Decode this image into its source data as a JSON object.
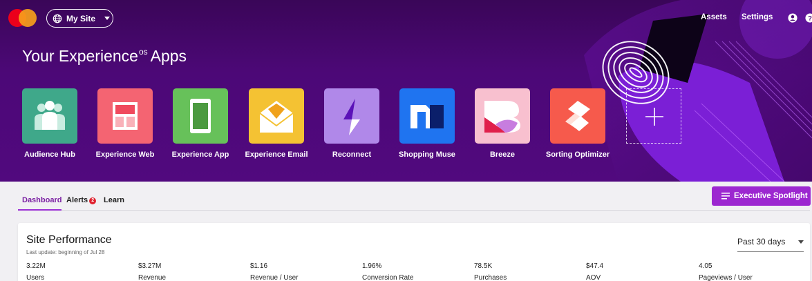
{
  "header": {
    "site_selector": "My Site",
    "nav": {
      "assets": "Assets",
      "settings": "Settings"
    }
  },
  "hero": {
    "title_main": "Your Experience",
    "title_sup": "os",
    "title_end": "Apps",
    "apps": [
      {
        "label": "Audience Hub",
        "color": "#3fa88a"
      },
      {
        "label": "Experience Web",
        "color": "#f46472"
      },
      {
        "label": "Experience App",
        "color": "#67c15a"
      },
      {
        "label": "Experience Email",
        "color": "#f4c233"
      },
      {
        "label": "Reconnect",
        "color": "#b088e9"
      },
      {
        "label": "Shopping Muse",
        "color": "#1f74f0"
      },
      {
        "label": "Breeze",
        "color": "#f8c0cf"
      },
      {
        "label": "Sorting Optimizer",
        "color": "#f65a4c"
      }
    ]
  },
  "tabs": {
    "dashboard": "Dashboard",
    "alerts": "Alerts",
    "alerts_count": "2",
    "learn": "Learn"
  },
  "actions": {
    "executive_spotlight": "Executive Spotlight"
  },
  "performance": {
    "title": "Site Performance",
    "subtitle": "Last update: beginning of Jul 28",
    "range": "Past 30 days",
    "metrics": [
      {
        "value": "3.22M",
        "label": "Users"
      },
      {
        "value": "$3.27M",
        "label": "Revenue"
      },
      {
        "value": "$1.16",
        "label": "Revenue / User"
      },
      {
        "value": "1.96%",
        "label": "Conversion Rate"
      },
      {
        "value": "78.5K",
        "label": "Purchases"
      },
      {
        "value": "$47.4",
        "label": "AOV"
      },
      {
        "value": "4.05",
        "label": "Pageviews / User"
      }
    ]
  },
  "colors": {
    "accent": "#9c27d0",
    "hero_bg": "#4c0877"
  }
}
